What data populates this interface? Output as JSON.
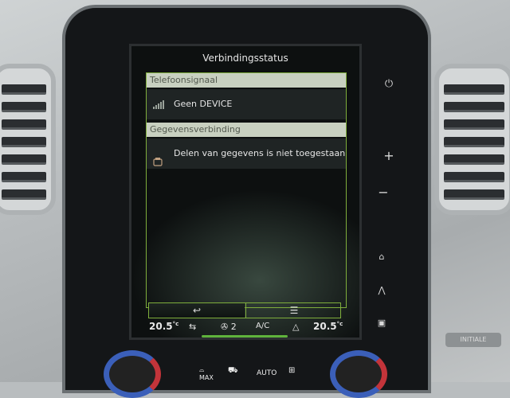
{
  "screen": {
    "title": "Verbindingsstatus",
    "sections": [
      {
        "header": "Telefoonsignaal",
        "row": {
          "icon": "signal-bars-icon",
          "text": "Geen DEVICE"
        }
      },
      {
        "header": "Gegevensverbinding",
        "row": {
          "icon": "data-sharing-icon",
          "text": "Delen van gegevens is niet toegestaan"
        }
      }
    ],
    "bottom_bar": {
      "back_icon": "↩",
      "list_icon": "☰"
    }
  },
  "climate": {
    "left_temp": "20.5",
    "right_temp": "20.5",
    "unit": "°c",
    "fan_level": "2",
    "ac_label": "A/C"
  },
  "hardware": {
    "max_label": "MAX",
    "auto_label": "AUTO"
  },
  "badge_text": "INITIALE",
  "colors": {
    "accent": "#7fae3c",
    "section_header_bg": "#c8d0c0"
  }
}
